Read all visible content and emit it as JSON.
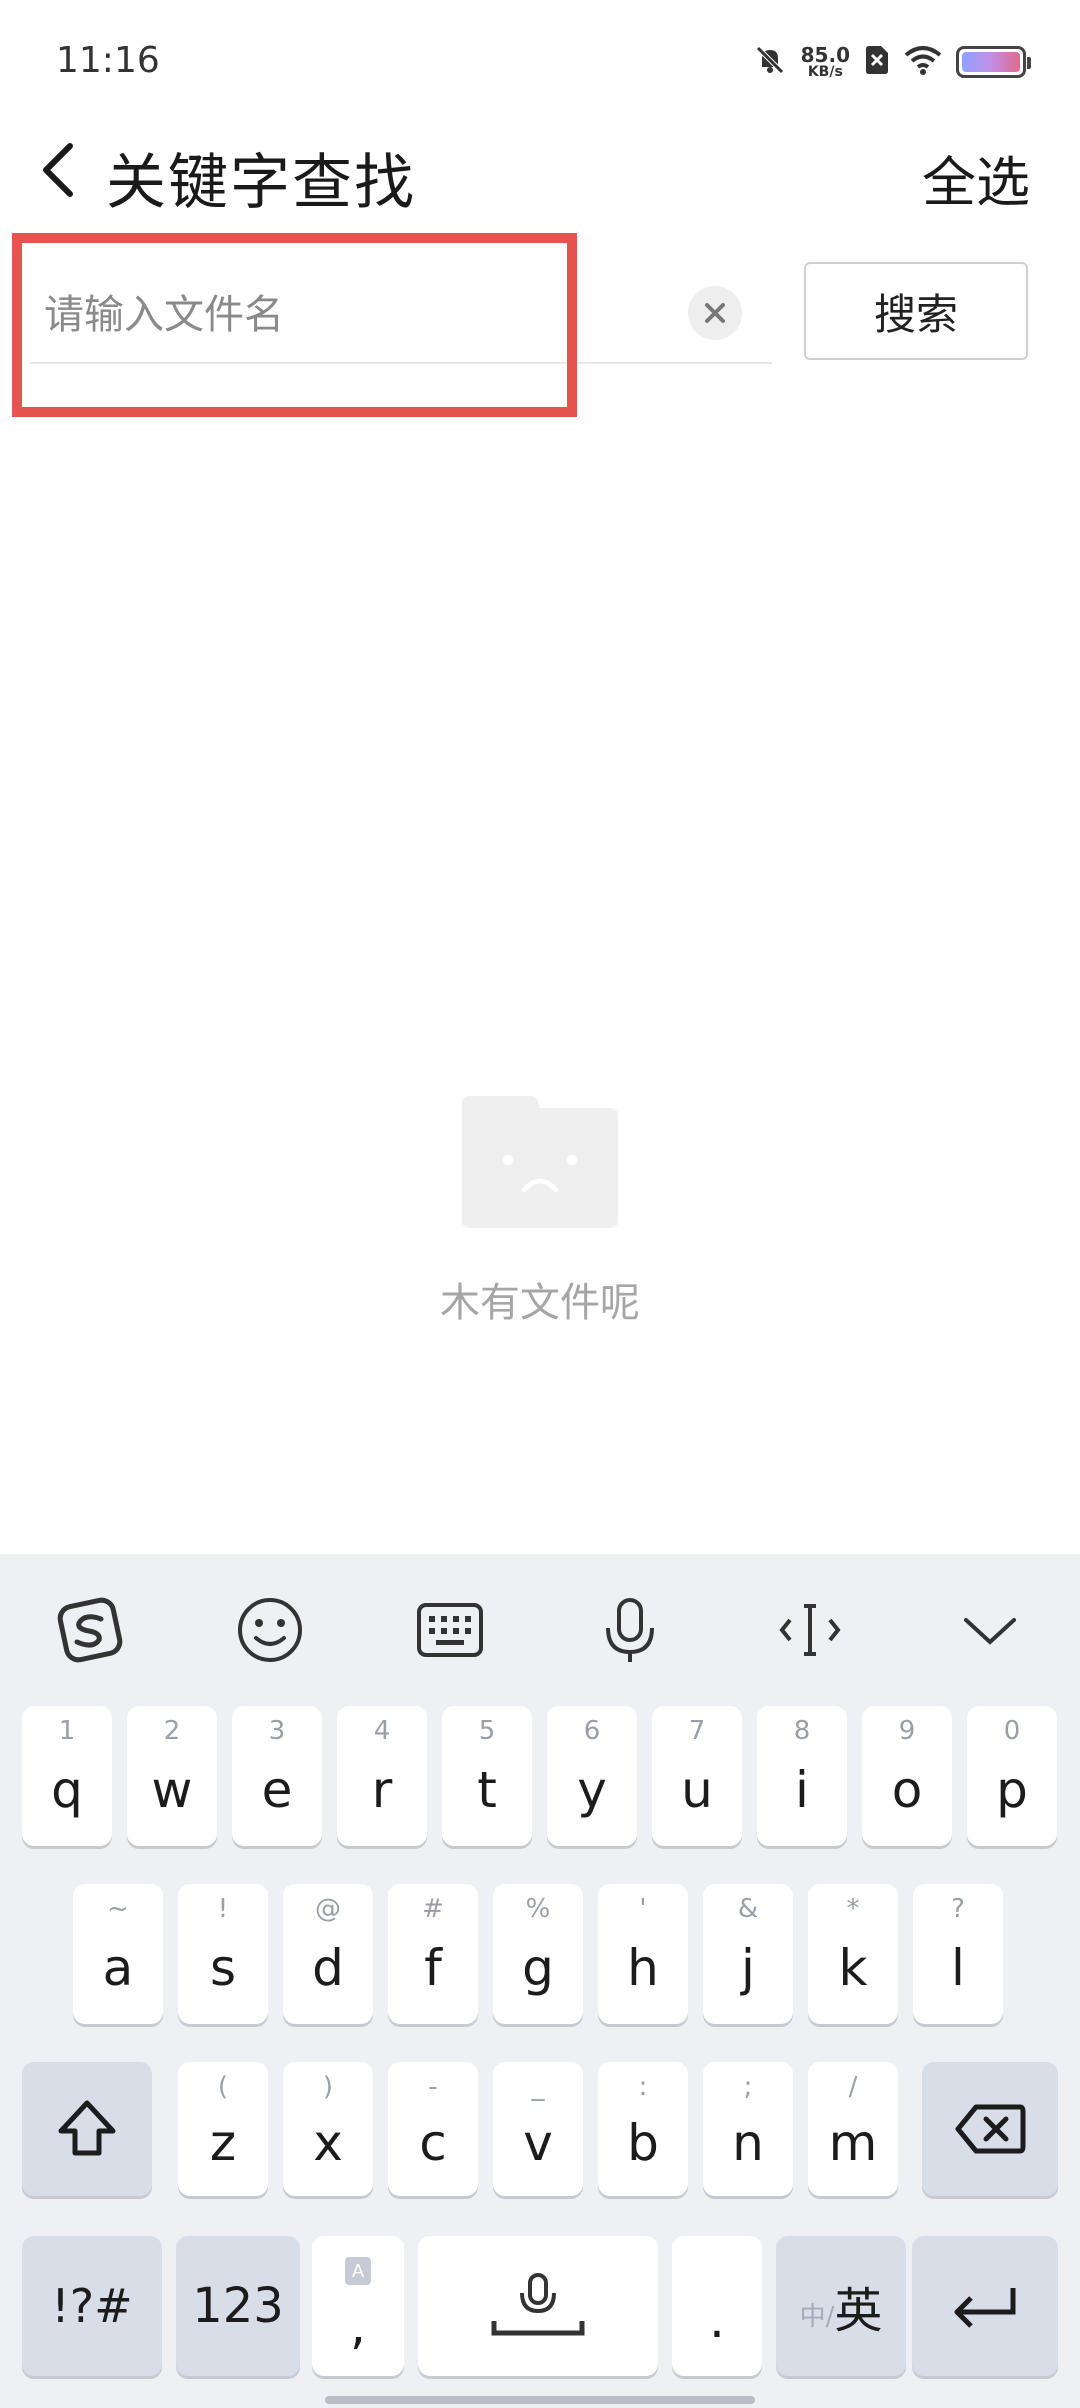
{
  "status_bar": {
    "time": "11:16",
    "net_speed_value": "85.0",
    "net_speed_unit": "KB/s"
  },
  "header": {
    "title": "关键字查找",
    "select_all_label": "全选"
  },
  "search": {
    "placeholder": "请输入文件名",
    "value": "",
    "button_label": "搜索"
  },
  "empty_state": {
    "message": "木有文件呢"
  },
  "keyboard": {
    "row1": [
      {
        "hint": "1",
        "label": "q"
      },
      {
        "hint": "2",
        "label": "w"
      },
      {
        "hint": "3",
        "label": "e"
      },
      {
        "hint": "4",
        "label": "r"
      },
      {
        "hint": "5",
        "label": "t"
      },
      {
        "hint": "6",
        "label": "y"
      },
      {
        "hint": "7",
        "label": "u"
      },
      {
        "hint": "8",
        "label": "i"
      },
      {
        "hint": "9",
        "label": "o"
      },
      {
        "hint": "0",
        "label": "p"
      }
    ],
    "row2": [
      {
        "hint": "~",
        "label": "a"
      },
      {
        "hint": "!",
        "label": "s"
      },
      {
        "hint": "@",
        "label": "d"
      },
      {
        "hint": "#",
        "label": "f"
      },
      {
        "hint": "%",
        "label": "g"
      },
      {
        "hint": "'",
        "label": "h"
      },
      {
        "hint": "&",
        "label": "j"
      },
      {
        "hint": "*",
        "label": "k"
      },
      {
        "hint": "?",
        "label": "l"
      }
    ],
    "row3": [
      {
        "hint": "(",
        "label": "z"
      },
      {
        "hint": ")",
        "label": "x"
      },
      {
        "hint": "-",
        "label": "c"
      },
      {
        "hint": "_",
        "label": "v"
      },
      {
        "hint": ":",
        "label": "b"
      },
      {
        "hint": ";",
        "label": "n"
      },
      {
        "hint": "/",
        "label": "m"
      }
    ],
    "symbols_label": "!?#",
    "numbers_label": "123",
    "comma_label": ",",
    "period_label": ".",
    "lang_small": "中/",
    "lang_label": "英"
  }
}
